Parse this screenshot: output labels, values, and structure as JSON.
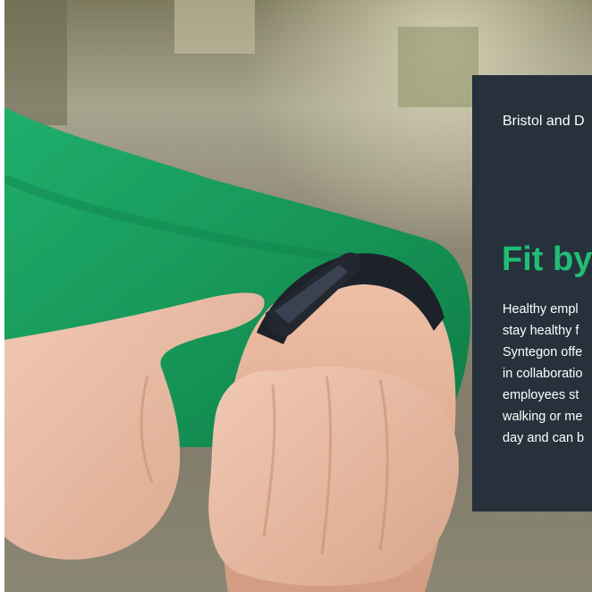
{
  "card": {
    "location": "Bristol and D",
    "title": "Fit by",
    "body_lines": [
      "Healthy empl",
      "stay healthy f",
      "Syntegon offe",
      "in collaboratio",
      "employees st",
      "walking or me",
      "day and can b"
    ]
  },
  "hero": {
    "image": "hand-tapping-fitness-tracker-photo"
  },
  "colors": {
    "card_background": "#26313c",
    "title_accent": "#1fbe77"
  }
}
